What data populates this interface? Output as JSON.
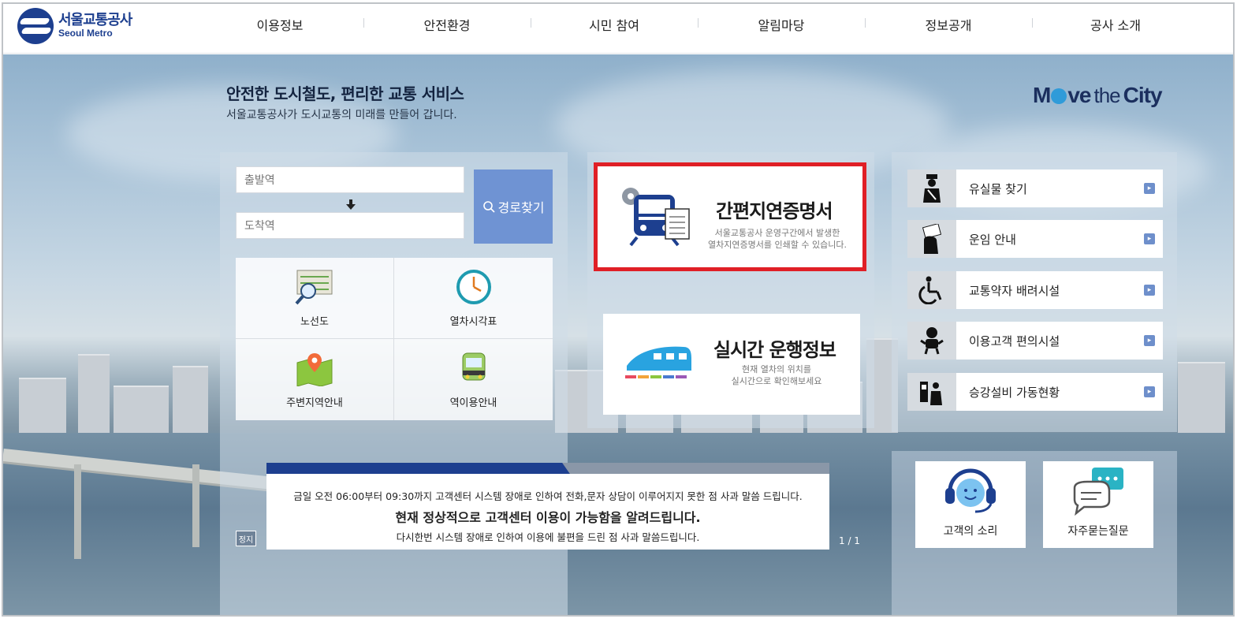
{
  "header": {
    "logo_ko": "서울교통공사",
    "logo_en": "Seoul Metro",
    "nav": [
      "이용정보",
      "안전환경",
      "시민 참여",
      "알림마당",
      "정보공개",
      "공사 소개"
    ]
  },
  "hero": {
    "title": "안전한 도시철도, 편리한 교통 서비스",
    "subtitle": "서울교통공사가 도시교통의 미래를 만들어 갑니다.",
    "slogan_move": "M",
    "slogan_ve": "ve",
    "slogan_the": "the",
    "slogan_city": "City"
  },
  "route": {
    "from_placeholder": "출발역",
    "to_placeholder": "도착역",
    "button_label": "경로찾기"
  },
  "quick": [
    {
      "label": "노선도",
      "icon": "route-map-icon"
    },
    {
      "label": "열차시각표",
      "icon": "clock-icon"
    },
    {
      "label": "주변지역안내",
      "icon": "map-pin-icon"
    },
    {
      "label": "역이용안내",
      "icon": "train-front-icon"
    }
  ],
  "cards": {
    "delay": {
      "title": "간편지연증명서",
      "desc1": "서울교통공사 운영구간에서 발생한",
      "desc2": "열차지연증명서를 인쇄할 수 있습니다."
    },
    "realtime": {
      "title": "실시간 운행정보",
      "desc1": "현재 열차의 위치를",
      "desc2": "실시간으로 확인해보세요"
    }
  },
  "services": [
    {
      "label": "유실물 찾기",
      "icon": "lost-item-icon"
    },
    {
      "label": "운임 안내",
      "icon": "ticket-icon"
    },
    {
      "label": "교통약자 배려시설",
      "icon": "wheelchair-icon"
    },
    {
      "label": "이용고객 편의시설",
      "icon": "baby-icon"
    },
    {
      "label": "승강설비 가동현황",
      "icon": "elevator-icon"
    }
  ],
  "help": {
    "voice": "고객의 소리",
    "faq": "자주묻는질문"
  },
  "notice": {
    "line1": "금일 오전 06:00부터 09:30까지 고객센터 시스템 장애로 인하여 전화,문자 상담이 이루어지지 못한 점 사과 말씀 드립니다.",
    "line2": "현재 정상적으로 고객센터 이용이 가능함을 알려드립니다.",
    "line3": "다시한번 시스템 장애로 인하여 이용에 불편을 드린 점 사과 말씀드립니다.",
    "stop_label": "정지",
    "pager": "1 / 1"
  },
  "colors": {
    "brand": "#1d3f8f",
    "route_button": "#6f93d3",
    "highlight_border": "#e01f26",
    "arrow_badge": "#6e8fcb"
  }
}
